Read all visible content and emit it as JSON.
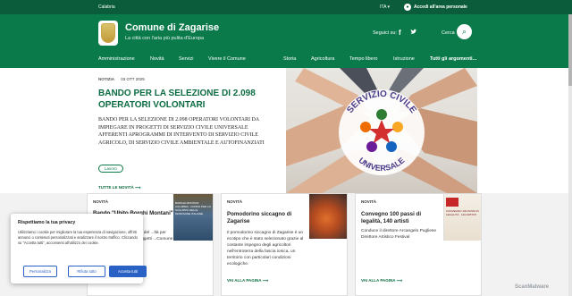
{
  "slimbar": {
    "region": "Calabria",
    "language": "ITA ▾",
    "reserved_area": "Accedi all'area personale"
  },
  "header": {
    "title": "Comune di Zagarise",
    "tagline": "La città con l'aria più pulita d'Europa",
    "social_label": "Seguici su:",
    "facebook": "f",
    "twitter": "🐦",
    "search_label": "Cerca",
    "search_icon": "⌕"
  },
  "nav": {
    "left": [
      "Amministrazione",
      "Novità",
      "Servizi",
      "Vivere il Comune"
    ],
    "right": [
      "Storia",
      "Agricoltura",
      "Tempo libero",
      "Istruzione",
      "Tutti gli argomenti..."
    ]
  },
  "hero": {
    "category": "NOTIZIA",
    "date": "03 OTT 2025",
    "headline": "BANDO PER LA SELEZIONE DI 2.098 OPERATORI VOLONTARI",
    "abstract": "BANDO PER LA SELEZIONE DI 2.098 OPERATORI VOLONTARI DA IMPIEGARE IN PROGETTI DI SERVIZIO CIVILE UNIVERSALE AFFERENTI APROGRAMMI DI INTERVENTO DI SERVIZIO CIVILE AGRICOLO, DI SERVIZIO CIVILE AMBIENTALE E AUTOFINANZIATI",
    "tag": "Lavoro",
    "all_news": "TUTTE LE NOVITÀ",
    "image_caption_top": "SERVIZIO CIVILE",
    "image_caption_bottom": "UNIVERSALE"
  },
  "cards": [
    {
      "label": "NOVITÀ",
      "title": "Bando \"Ubito Borghi Montani\"",
      "body": "...zione del ...ltà per ...di soggetti ...Comune di",
      "thumb_text": "BORGHI MONTANI CALABRIA · FONDO PER LO SVILUPPO DELLE MONTAGNE ITALIANE"
    },
    {
      "label": "NOVITÀ",
      "title": "Pomodorino siccagno di Zagarise",
      "body": "Il pomodorino siccagno di Zagarise è un ecotipo che è stato selezionato grazie al costante impegno degli agricoltori nell'entroterra della fascia ionica, un territorio con particolari condizioni ecologiche.",
      "more": "VAI ALLA PAGINA"
    },
    {
      "label": "NOVITÀ",
      "title": "Convegno 100 passi di legalità, 140 artisti",
      "body": "Conduce il direttore Arcangelo Pugliese Direttore Artistico Festival",
      "more": "VAI ALLA PAGINA",
      "thumb_text": "CONVEGNO 100 PASSI DI LEGALITÀ · 140 ARTISTI"
    }
  ],
  "cookie": {
    "title": "Rispettiamo la tua privacy",
    "text": "Utilizziamo i cookie per migliorare la tua esperienza di navigazione, offrirti annunci o contenuti personalizzati e analizzare il nostro traffico. Cliccando su \"Accetta tutti\", acconsenti all'utilizzo dei cookie.",
    "btn_personalize": "Personalizza",
    "btn_reject": "Rifiuta tutto",
    "btn_accept": "Accetta tutti"
  },
  "watermark": "ScanMalware",
  "colors": {
    "brand_green": "#0b7a4b",
    "dark_green": "#0a5c3a",
    "cookie_blue": "#2962c4"
  }
}
